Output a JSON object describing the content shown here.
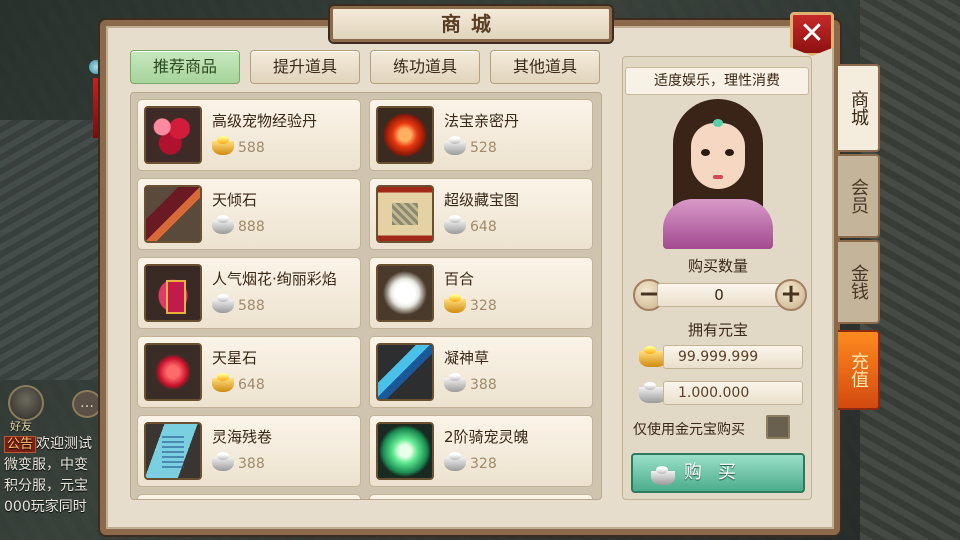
{
  "panel": {
    "title": "商城",
    "close_label": "✕"
  },
  "tabs": [
    {
      "label": "推荐商品",
      "active": true
    },
    {
      "label": "提升道具",
      "active": false
    },
    {
      "label": "练功道具",
      "active": false
    },
    {
      "label": "其他道具",
      "active": false
    }
  ],
  "items": [
    {
      "name": "高级宠物经验丹",
      "price": "588",
      "currency": "gold",
      "icon": "pet-pill-icon"
    },
    {
      "name": "法宝亲密丹",
      "price": "528",
      "currency": "silver",
      "icon": "fabao-pill-icon"
    },
    {
      "name": "天倾石",
      "price": "888",
      "currency": "silver",
      "icon": "tianqing-stone-icon"
    },
    {
      "name": "超级藏宝图",
      "price": "648",
      "currency": "silver",
      "icon": "treasure-map-icon"
    },
    {
      "name": "人气烟花·绚丽彩焰",
      "price": "588",
      "currency": "silver",
      "icon": "firework-icon"
    },
    {
      "name": "百合",
      "price": "328",
      "currency": "gold",
      "icon": "lily-icon"
    },
    {
      "name": "天星石",
      "price": "648",
      "currency": "gold",
      "icon": "tianxing-stone-icon"
    },
    {
      "name": "凝神草",
      "price": "388",
      "currency": "silver",
      "icon": "ningshen-herb-icon"
    },
    {
      "name": "灵海残卷",
      "price": "388",
      "currency": "silver",
      "icon": "linghai-scroll-icon"
    },
    {
      "name": "2阶骑宠灵魄",
      "price": "328",
      "currency": "silver",
      "icon": "mount-soul-icon"
    }
  ],
  "side": {
    "notice": "适度娱乐，理性消费",
    "qty_label": "购买数量",
    "qty_value": "0",
    "own_label": "拥有元宝",
    "gold_balance": "99.999.999",
    "silver_balance": "1.000.000",
    "only_gold_label": "仅使用金元宝购买",
    "buy_label": "购买"
  },
  "vertical_tabs": [
    {
      "label": "商城",
      "active": true
    },
    {
      "label": "会员",
      "active": false
    },
    {
      "label": "金钱",
      "active": false
    },
    {
      "label": "充值",
      "active": false
    }
  ],
  "chat": {
    "friend_label": "好友",
    "notice_tag": "公告",
    "lines": [
      "欢迎测试",
      "微变服，中变",
      "积分服，元宝",
      "000玩家同时"
    ]
  },
  "colors": {
    "gold": "#e0a020",
    "silver": "#b0b0b0",
    "accent_green": "#4cac8c",
    "close_red": "#c62a2a",
    "recharge_orange": "#e86a18"
  }
}
